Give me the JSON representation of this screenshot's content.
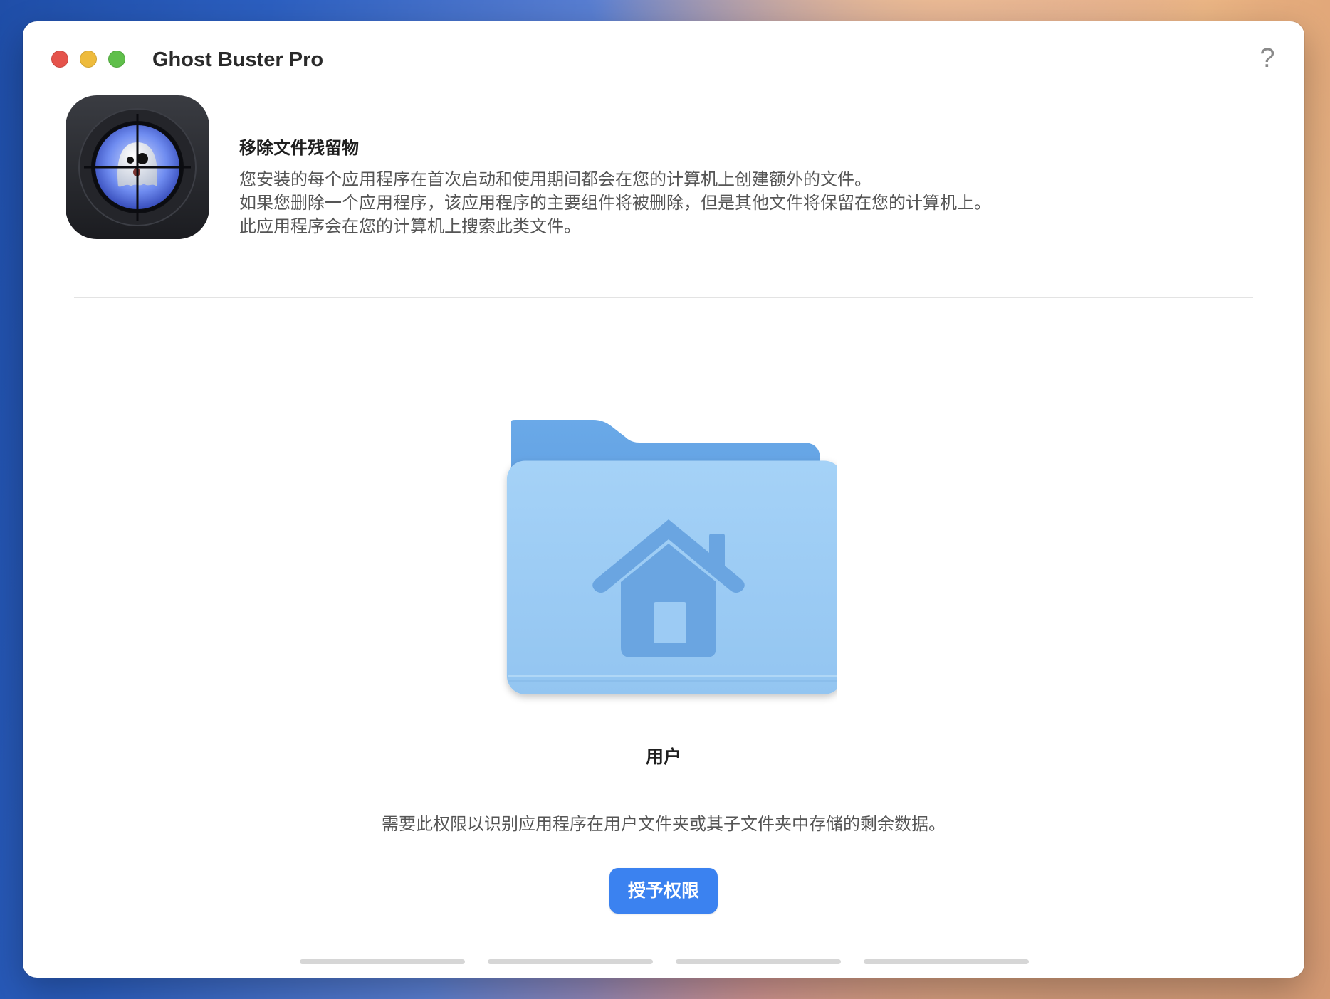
{
  "window": {
    "title": "Ghost Buster Pro",
    "help_glyph": "?"
  },
  "intro": {
    "heading": "移除文件残留物",
    "lines": [
      "您安装的每个应用程序在首次启动和使用期间都会在您的计算机上创建额外的文件。",
      "如果您删除一个应用程序，该应用程序的主要组件将被删除，但是其他文件将保留在您的计算机上。",
      "此应用程序会在您的计算机上搜索此类文件。"
    ]
  },
  "permission": {
    "folder_icon": "home-folder-icon",
    "folder_label": "用户",
    "explanation": "需要此权限以识别应用程序在用户文件夹或其子文件夹中存储的剩余数据。",
    "grant_button_label": "授予权限"
  },
  "pager": {
    "steps": 4
  },
  "colors": {
    "accent": "#3b82f0",
    "folder_front": "#9ccbf4",
    "folder_back": "#5b9ee0",
    "close": "#e5534b",
    "minimize": "#eebb3c",
    "zoom": "#5fbf4a"
  }
}
